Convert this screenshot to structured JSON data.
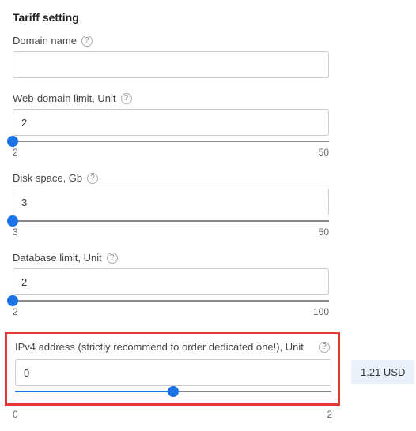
{
  "title": "Tariff setting",
  "domainName": {
    "label": "Domain name",
    "value": ""
  },
  "webDomain": {
    "label": "Web-domain limit, Unit",
    "value": "2",
    "min": 2,
    "max": 50
  },
  "diskSpace": {
    "label": "Disk space, Gb",
    "value": "3",
    "min": 3,
    "max": 50
  },
  "databaseLimit": {
    "label": "Database limit, Unit",
    "value": "2",
    "min": 2,
    "max": 100
  },
  "ipv4": {
    "label": "IPv4 address (strictly recommend to order dedicated one!), Unit",
    "value": "0",
    "min": 0,
    "max": 2,
    "thumbPos": 50,
    "price": "1.21 USD"
  },
  "helpGlyph": "?"
}
